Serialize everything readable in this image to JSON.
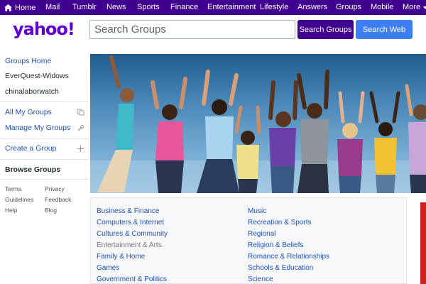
{
  "nav": {
    "home": "Home",
    "links": [
      "Mail",
      "Tumblr",
      "News",
      "Sports",
      "Finance",
      "Entertainment",
      "Lifestyle",
      "Answers",
      "Groups",
      "Mobile"
    ],
    "more": "More"
  },
  "logo": "yahoo!",
  "search": {
    "placeholder": "Search Groups",
    "groups_button": "Search Groups",
    "web_button": "Search Web"
  },
  "sidebar": {
    "groups_home": "Groups Home",
    "my_groups_list": [
      "EverQuest-Widows",
      "chinalaborwatch"
    ],
    "all_my_groups": "All My Groups",
    "manage_my_groups": "Manage My Groups",
    "create_group": "Create a Group",
    "browse_groups": "Browse Groups",
    "footer": [
      "Terms",
      "Privacy",
      "Guidelines",
      "Feedback",
      "Help",
      "Blog"
    ]
  },
  "categories": {
    "left": [
      "Business & Finance",
      "Computers & Internet",
      "Cultures & Community",
      "Entertainment & Arts",
      "Family & Home",
      "Games",
      "Government & Politics"
    ],
    "right": [
      "Music",
      "Recreation & Sports",
      "Regional",
      "Religion & Beliefs",
      "Romance & Relationships",
      "Schools & Education",
      "Science"
    ]
  },
  "colors": {
    "brand_purple": "#400090",
    "logo_purple": "#6001d2",
    "web_blue": "#3d7ff2",
    "link_blue": "#1c4fb5"
  }
}
